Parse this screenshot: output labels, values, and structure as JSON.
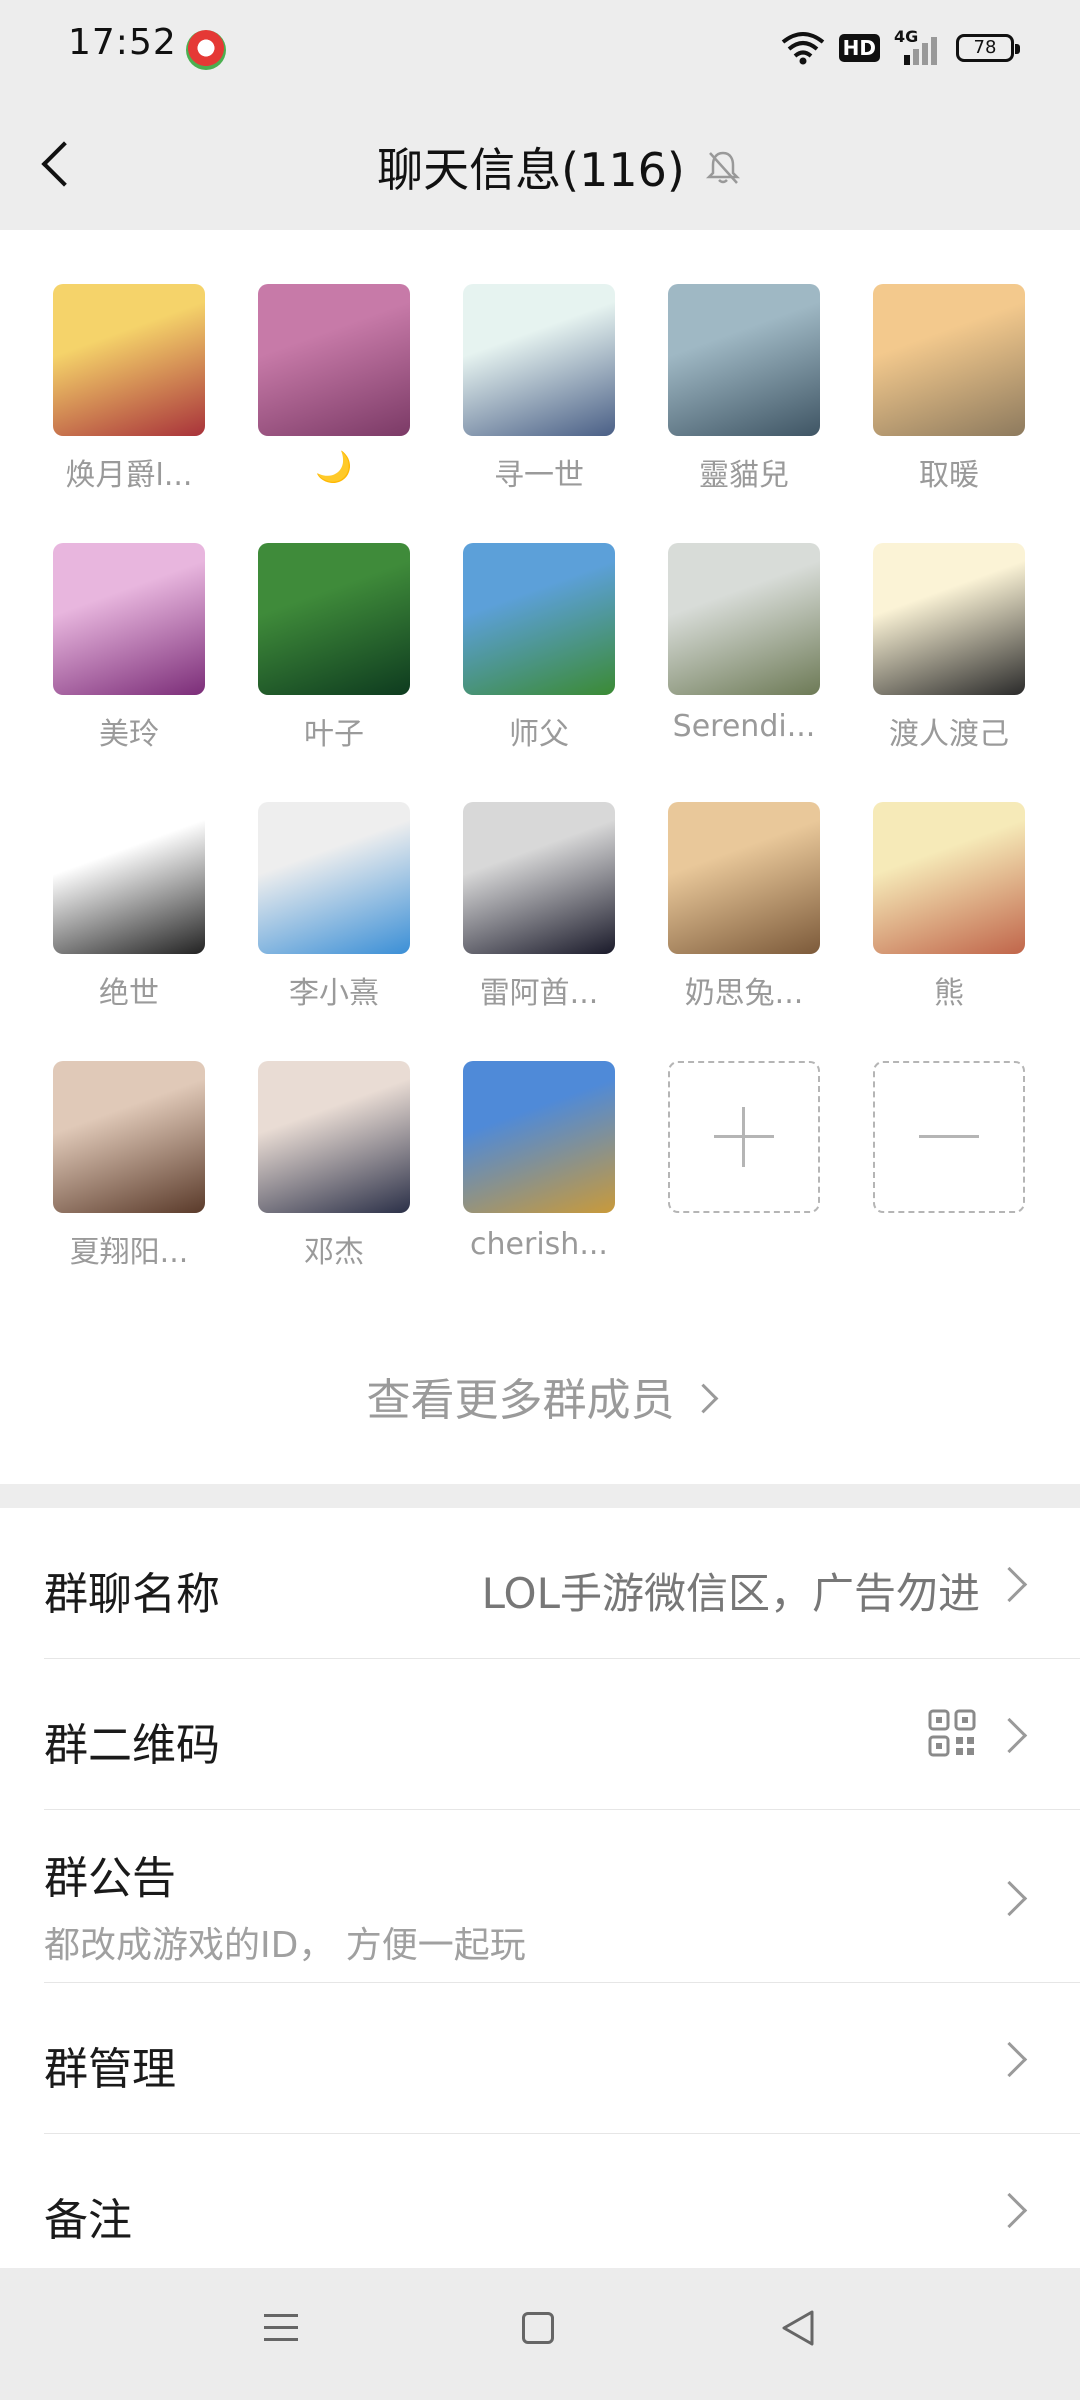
{
  "status_bar": {
    "time": "17:52",
    "hd_label": "HD",
    "network_label": "4G",
    "battery": "78",
    "icons": [
      "app-notification-icon",
      "wifi-icon",
      "hd-icon",
      "signal-icon",
      "battery-icon"
    ]
  },
  "header": {
    "title": "聊天信息(116)",
    "icons": [
      "back-icon",
      "mute-bell-icon"
    ]
  },
  "members": [
    {
      "name": "焕月爵l...",
      "avatar_colors": [
        "#f5d36a",
        "#a8323a"
      ]
    },
    {
      "name": "🌙",
      "avatar_colors": [
        "#c77aa8",
        "#7b3a66"
      ]
    },
    {
      "name": "寻一世",
      "avatar_colors": [
        "#e6f3f0",
        "#4a5f86"
      ]
    },
    {
      "name": "靈貓兒",
      "avatar_colors": [
        "#9fb8c4",
        "#3f5564"
      ]
    },
    {
      "name": "取暖",
      "avatar_colors": [
        "#f3c98d",
        "#8d7a5e"
      ]
    },
    {
      "name": "美玲",
      "avatar_colors": [
        "#e8b6de",
        "#7b2d78"
      ]
    },
    {
      "name": "叶子",
      "avatar_colors": [
        "#3f8b3a",
        "#0e3b1f"
      ]
    },
    {
      "name": "师父",
      "avatar_colors": [
        "#5ca0d9",
        "#3b8a34"
      ]
    },
    {
      "name": "Serendi...",
      "avatar_colors": [
        "#d8dcd8",
        "#6d7a56"
      ]
    },
    {
      "name": "渡人渡己",
      "avatar_colors": [
        "#fbf3d6",
        "#2a2a2a"
      ]
    },
    {
      "name": "绝世",
      "avatar_colors": [
        "#ffffff",
        "#222222"
      ]
    },
    {
      "name": "李小熹",
      "avatar_colors": [
        "#eeeeee",
        "#3b8fd6"
      ]
    },
    {
      "name": "雷阿酋...",
      "avatar_colors": [
        "#d8d8d8",
        "#1a1a2a"
      ]
    },
    {
      "name": "奶思兔...",
      "avatar_colors": [
        "#e9c89a",
        "#7c5a3a"
      ]
    },
    {
      "name": "熊",
      "avatar_colors": [
        "#f6eab8",
        "#c0654a"
      ]
    },
    {
      "name": "夏翔阳...",
      "avatar_colors": [
        "#e0c9b8",
        "#5a3a2a"
      ]
    },
    {
      "name": "邓杰",
      "avatar_colors": [
        "#e9dcd4",
        "#2b3048"
      ]
    },
    {
      "name": "cherish...",
      "avatar_colors": [
        "#4f8ad8",
        "#c99a3a"
      ]
    }
  ],
  "member_actions": {
    "add_icon": "plus-icon",
    "remove_icon": "minus-icon"
  },
  "view_more_label": "查看更多群成员",
  "settings": {
    "group_name": {
      "label": "群聊名称",
      "value": "LOL手游微信区，广告勿进"
    },
    "group_qr": {
      "label": "群二维码",
      "icon": "qr-code-icon"
    },
    "announcement": {
      "label": "群公告",
      "subtitle": "都改成游戏的ID， 方便一起玩"
    },
    "management": {
      "label": "群管理"
    },
    "remark": {
      "label": "备注"
    }
  },
  "nav_bar": {
    "icons": [
      "menu-icon",
      "home-icon",
      "back-triangle-icon"
    ]
  }
}
